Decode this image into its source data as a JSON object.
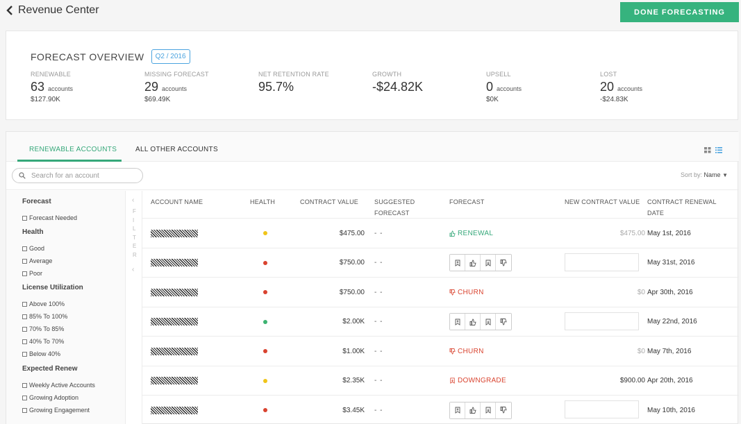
{
  "header": {
    "title": "Revenue Center",
    "done_label": "DONE FORECASTING"
  },
  "overview": {
    "title": "FORECAST OVERVIEW",
    "period": "Q2 / 2016",
    "metrics": [
      {
        "label": "RENEWABLE",
        "value": "63",
        "unit": "accounts",
        "sub": "$127.90K"
      },
      {
        "label": "MISSING FORECAST",
        "value": "29",
        "unit": "accounts",
        "sub": "$69.49K"
      },
      {
        "label": "NET RETENTION RATE",
        "value": "95.7%",
        "unit": "",
        "sub": ""
      },
      {
        "label": "GROWTH",
        "value": "-$24.82K",
        "unit": "",
        "sub": ""
      },
      {
        "label": "UPSELL",
        "value": "0",
        "unit": "accounts",
        "sub": "$0K"
      },
      {
        "label": "LOST",
        "value": "20",
        "unit": "accounts",
        "sub": "-$24.83K"
      }
    ]
  },
  "tabs": [
    {
      "label": "RENEWABLE ACCOUNTS",
      "active": true
    },
    {
      "label": "ALL OTHER ACCOUNTS",
      "active": false
    }
  ],
  "search": {
    "placeholder": "Search for an account",
    "value": ""
  },
  "sort": {
    "label": "Sort by:",
    "value": "Name"
  },
  "filters": {
    "groups": [
      {
        "title": "Forecast",
        "options": [
          "Forecast Needed"
        ]
      },
      {
        "title": "Health",
        "options": [
          "Good",
          "Average",
          "Poor"
        ]
      },
      {
        "title": "License Utilization",
        "options": [
          "Above 100%",
          "85% To 100%",
          "70% To 85%",
          "40% To 70%",
          "Below 40%"
        ]
      },
      {
        "title": "Expected Renew",
        "options": [
          "Weekly Active Accounts",
          "Growing Adoption",
          "Growing Engagement"
        ]
      }
    ],
    "strip_label": "FILTER"
  },
  "table": {
    "columns": {
      "account_name": "ACCOUNT NAME",
      "health": "HEALTH",
      "contract_value": "CONTRACT VALUE",
      "suggested_1": "SUGGESTED",
      "suggested_2": "FORECAST",
      "forecast": "FORECAST",
      "new_contract_value": "NEW CONTRACT VALUE",
      "renewal_1": "CONTRACT RENEWAL",
      "renewal_2": "DATE"
    },
    "health_colors": {
      "good": "#3cb371",
      "average": "#f0c419",
      "poor": "#d9432f"
    },
    "forecast_colors": {
      "renewal": "#36a87a",
      "churn": "#d9432f",
      "downgrade": "#d9432f"
    },
    "rows": [
      {
        "health": "average",
        "contract_value": "$475.00",
        "suggested": "- -",
        "forecast": "RENEWAL",
        "forecast_type": "renewal",
        "new_value": "$475.00",
        "new_value_dark": false,
        "date": "May 1st, 2016"
      },
      {
        "health": "poor",
        "contract_value": "$750.00",
        "suggested": "- -",
        "forecast": "",
        "forecast_type": "buttons",
        "new_value": "",
        "new_value_dark": false,
        "date": "May 31st, 2016"
      },
      {
        "health": "poor",
        "contract_value": "$750.00",
        "suggested": "- -",
        "forecast": "CHURN",
        "forecast_type": "churn",
        "new_value": "$0",
        "new_value_dark": false,
        "date": "Apr 30th, 2016"
      },
      {
        "health": "good",
        "contract_value": "$2.00K",
        "suggested": "- -",
        "forecast": "",
        "forecast_type": "buttons",
        "new_value": "",
        "new_value_dark": false,
        "date": "May 22nd, 2016"
      },
      {
        "health": "poor",
        "contract_value": "$1.00K",
        "suggested": "- -",
        "forecast": "CHURN",
        "forecast_type": "churn",
        "new_value": "$0",
        "new_value_dark": false,
        "date": "May 7th, 2016"
      },
      {
        "health": "average",
        "contract_value": "$2.35K",
        "suggested": "- -",
        "forecast": "DOWNGRADE",
        "forecast_type": "downgrade",
        "new_value": "$900.00",
        "new_value_dark": true,
        "date": "Apr 20th, 2016"
      },
      {
        "health": "poor",
        "contract_value": "$3.45K",
        "suggested": "- -",
        "forecast": "",
        "forecast_type": "buttons",
        "new_value": "",
        "new_value_dark": false,
        "date": "May 10th, 2016"
      }
    ]
  }
}
